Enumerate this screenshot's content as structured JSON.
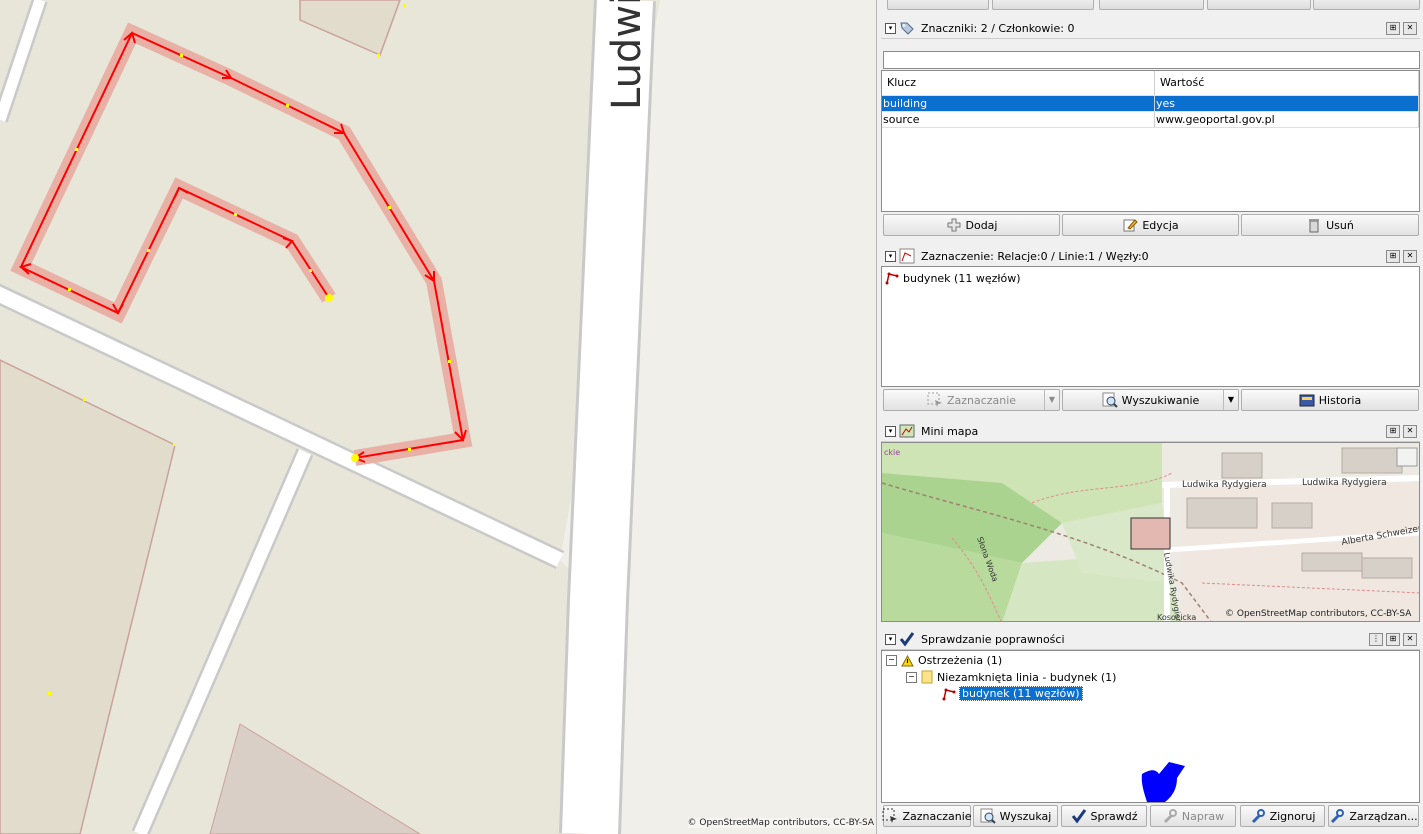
{
  "map": {
    "street_label": "Ludwi",
    "attribution": "© OpenStreetMap contributors, CC-BY-SA"
  },
  "tags_panel": {
    "title": "Znaczniki: 2 / Członkowie: 0",
    "col_key": "Klucz",
    "col_value": "Wartość",
    "rows": [
      {
        "key": "building",
        "value": "yes"
      },
      {
        "key": "source",
        "value": "www.geoportal.gov.pl"
      }
    ],
    "add_label": "Dodaj",
    "edit_label": "Edycja",
    "delete_label": "Usuń"
  },
  "selection_panel": {
    "title": "Zaznaczenie: Relacje:0 / Linie:1 / Węzły:0",
    "item": "budynek (11 węzłów)",
    "select_label": "Zaznaczanie",
    "search_label": "Wyszukiwanie",
    "history_label": "Historia"
  },
  "minimap_panel": {
    "title": "Mini mapa",
    "labels": [
      "Ludwika Rydygiera",
      "Ludwika Rydygiera",
      "Alberta Schweizera",
      "Słona Woda",
      "Kosocicka",
      "Ludwika Rydygiera",
      "ckie"
    ],
    "attribution": "© OpenStreetMap contributors, CC-BY-SA"
  },
  "validator_panel": {
    "title": "Sprawdzanie poprawności",
    "warnings": "Ostrzeżenia (1)",
    "group": "Niezamknięta linia - budynek (1)",
    "item": "budynek (11 węzłów)",
    "select_label": "Zaznaczanie",
    "lookup_label": "Wyszukaj",
    "check_label": "Sprawdź",
    "fix_label": "Napraw",
    "ignore_label": "Zignoruj",
    "manage_label": "Zarządzan..."
  },
  "colors": {
    "accent": "#0b6fd0",
    "way": "#ff0000",
    "highlight": "#e9b1a6",
    "node": "#ffff00",
    "cursor": "#0000ff"
  }
}
